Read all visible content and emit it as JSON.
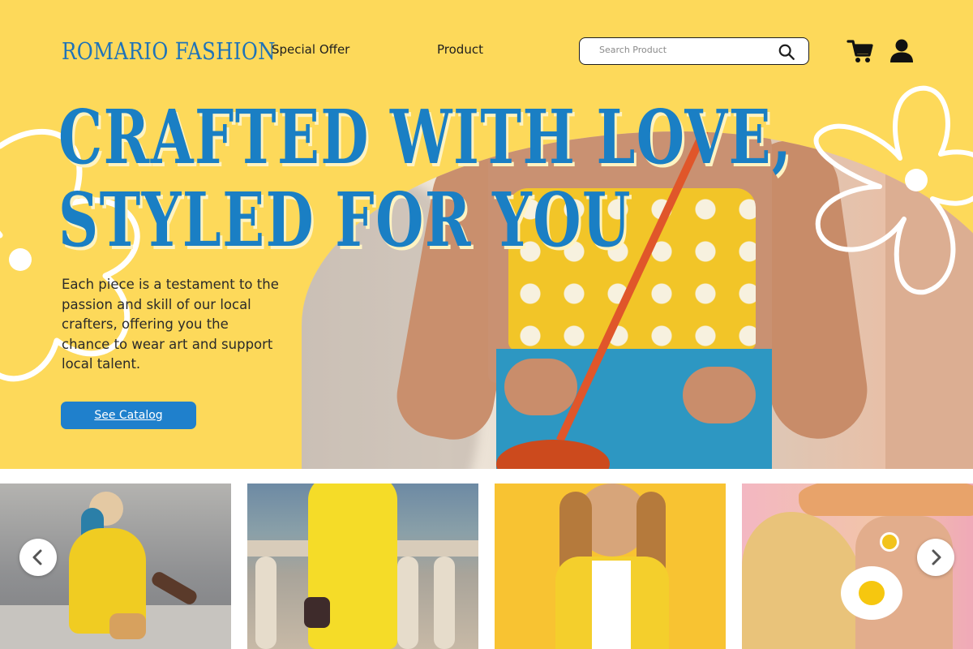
{
  "header": {
    "brand": "ROMARIO FASHION",
    "nav": [
      {
        "label": "Special Offer"
      },
      {
        "label": "Product"
      }
    ],
    "search": {
      "placeholder": "Search Product",
      "icon": "search-icon"
    },
    "icons": [
      "cart-icon",
      "user-icon"
    ]
  },
  "hero": {
    "headline_line1": "CRAFTED WITH LOVE,",
    "headline_line2": "STYLED FOR YOU",
    "description": "Each piece is a testament to the passion and skill of our local crafters, offering you the chance to wear art and support local talent.",
    "cta_label": "See Catalog"
  },
  "carousel": {
    "products": [
      {
        "image": "woman in yellow dress sitting with straw bag"
      },
      {
        "image": "woman in yellow jumpsuit by stone balustrade"
      },
      {
        "image": "woman in yellow leather jacket"
      },
      {
        "image": "blonde woman with fried-egg earring and bucket hat"
      }
    ],
    "prev_icon": "chevron-left-icon",
    "next_icon": "chevron-right-icon"
  },
  "colors": {
    "hero_background": "#fdd95a",
    "accent_blue": "#1f80cc",
    "headline_blue": "#1a7fc4",
    "text_dark": "#2a2a2a"
  }
}
